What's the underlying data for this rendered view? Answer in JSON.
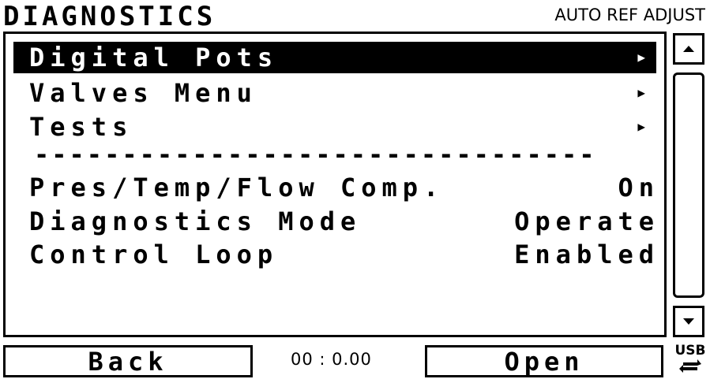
{
  "header": {
    "title": "DIAGNOSTICS",
    "mode": "AUTO REF ADJUST"
  },
  "menu": {
    "items": [
      {
        "label": "Digital Pots",
        "selected": true,
        "has_submenu": true
      },
      {
        "label": "Valves Menu",
        "has_submenu": true
      },
      {
        "label": "Tests",
        "has_submenu": true
      }
    ],
    "divider": "--------------------------------",
    "settings": [
      {
        "label": "Pres/Temp/Flow Comp.",
        "value": "On"
      },
      {
        "label": "Diagnostics Mode",
        "value": "Operate"
      },
      {
        "label": "Control Loop",
        "value": "Enabled"
      }
    ]
  },
  "footer": {
    "back_label": "Back",
    "timer": "00 : 0.00",
    "open_label": "Open",
    "usb_label": "USB"
  }
}
